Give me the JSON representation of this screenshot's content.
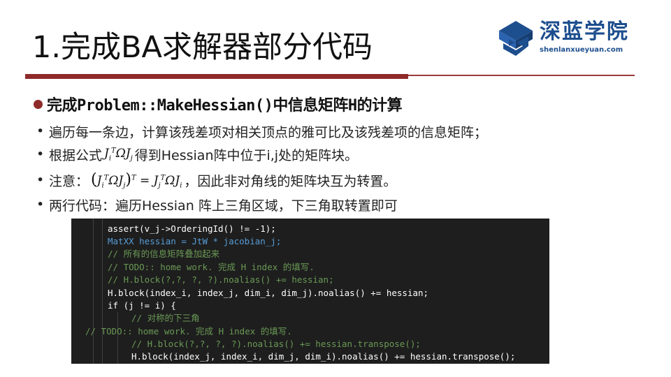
{
  "slide": {
    "title": "1.完成BA求解器部分代码",
    "brand": {
      "name": "深蓝学院",
      "url": "shenlanxueyuan.com",
      "color": "#1d4e8e"
    },
    "accent_color": "#8f2a2a",
    "headline": "完成Problem::MakeHessian()中信息矩阵H的计算",
    "bullets": [
      {
        "text": "遍历每一条边，计算该残差项对相关顶点的雅可比及该残差项的信息矩阵；"
      },
      {
        "pre": "根据公式",
        "post": "得到Hessian阵中位于i,j处的矩阵块。"
      },
      {
        "pre": "注意：",
        "post": "，因此非对角线的矩阵块互为转置。"
      },
      {
        "text": "两行代码：遍历Hessian 阵上三角区域，下三角取转置即可"
      }
    ],
    "code_lines": [
      "assert(v_j->OrderingId() != -1);",
      "MatXX hessian = JtW * jacobian_j;",
      "// 所有的信息矩阵叠加起来",
      "// TODO:: home work. 完成 H index 的填写.",
      "// H.block(?,?, ?, ?).noalias() += hessian;",
      "H.block(index_i, index_j, dim_i, dim_j).noalias() += hessian;",
      "if (j != i) {",
      "// 对称的下三角",
      "// TODO:: home work. 完成 H index 的填写.",
      "// H.block(?,?, ?, ?).noalias() += hessian.transpose();",
      "H.block(index_j, index_i, dim_j, dim_i).noalias() += hessian.transpose();"
    ]
  }
}
